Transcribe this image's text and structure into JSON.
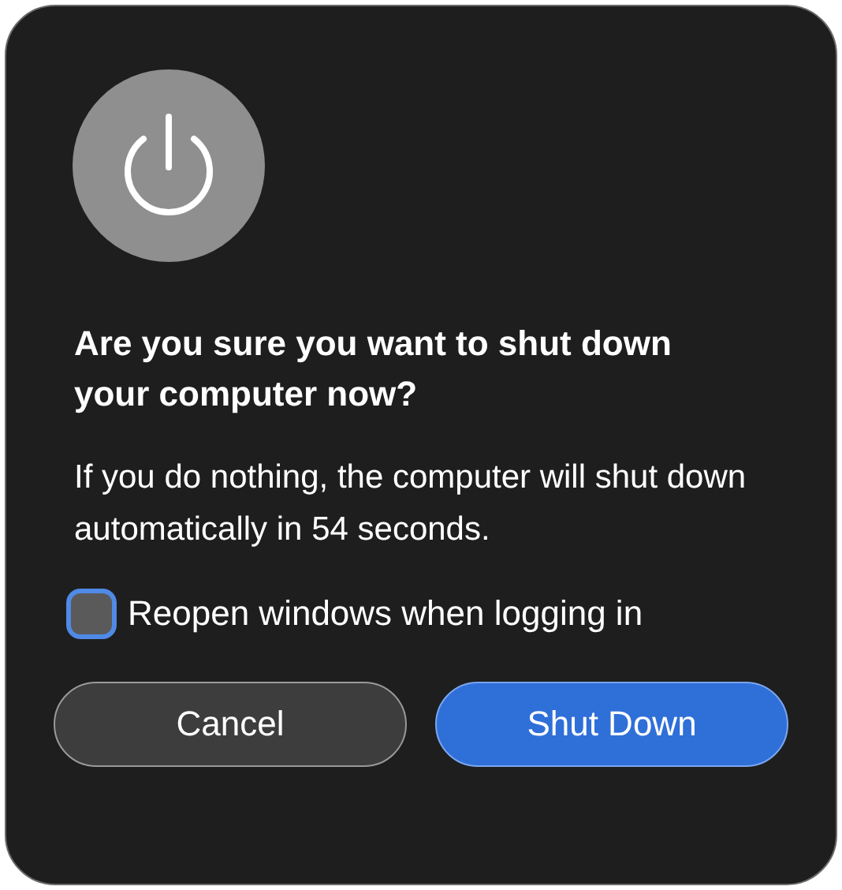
{
  "dialog": {
    "title": "Are you sure you want to shut down your computer now?",
    "message": "If you do nothing, the computer will shut down automatically in 54 seconds.",
    "checkbox": {
      "label": "Reopen windows when logging in",
      "checked": false,
      "focused": true
    },
    "buttons": [
      {
        "label": "Cancel",
        "kind": "secondary"
      },
      {
        "label": "Shut Down",
        "kind": "primary"
      }
    ]
  }
}
